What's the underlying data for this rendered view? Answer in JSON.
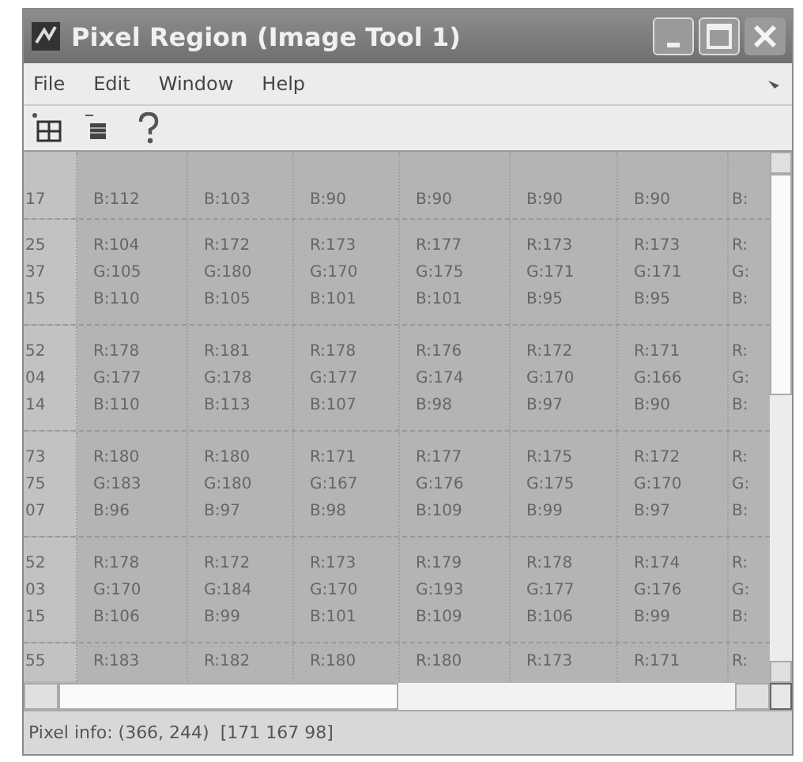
{
  "window": {
    "title": "Pixel Region (Image Tool 1)"
  },
  "menu": [
    "File",
    "Edit",
    "Window",
    "Help"
  ],
  "grid": {
    "rows": [
      {
        "kind": "cut-top",
        "cells": [
          "17",
          "B:112",
          "B:103",
          "B:90",
          "B:90",
          "B:90",
          "B:90",
          "B:"
        ]
      },
      {
        "kind": "full",
        "cells": [
          "25\n37\n15",
          "R:104\nG:105\nB:110",
          "R:172\nG:180\nB:105",
          "R:173\nG:170\nB:101",
          "R:177\nG:175\nB:101",
          "R:173\nG:171\nB:95",
          "R:173\nG:171\nB:95",
          "R:\nG:\nB:"
        ]
      },
      {
        "kind": "full",
        "cells": [
          "52\n04\n14",
          "R:178\nG:177\nB:110",
          "R:181\nG:178\nB:113",
          "R:178\nG:177\nB:107",
          "R:176\nG:174\nB:98",
          "R:172\nG:170\nB:97",
          "R:171\nG:166\nB:90",
          "R:\nG:\nB:"
        ]
      },
      {
        "kind": "full",
        "cells": [
          "73\n75\n07",
          "R:180\nG:183\nB:96",
          "R:180\nG:180\nB:97",
          "R:171\nG:167\nB:98",
          "R:177\nG:176\nB:109",
          "R:175\nG:175\nB:99",
          "R:172\nG:170\nB:97",
          "R:\nG:\nB:"
        ]
      },
      {
        "kind": "full",
        "cells": [
          "52\n03\n15",
          "R:178\nG:170\nB:106",
          "R:172\nG:184\nB:99",
          "R:173\nG:170\nB:101",
          "R:179\nG:193\nB:109",
          "R:178\nG:177\nB:106",
          "R:174\nG:176\nB:99",
          "R:\nG:\nB:"
        ]
      },
      {
        "kind": "cut-bottom",
        "cells": [
          "55",
          "R:183",
          "R:182",
          "R:180",
          "R:180",
          "R:173",
          "R:171",
          "R:"
        ]
      }
    ]
  },
  "status_bar": "Pixel info: (366, 244)  [171 167 98]"
}
